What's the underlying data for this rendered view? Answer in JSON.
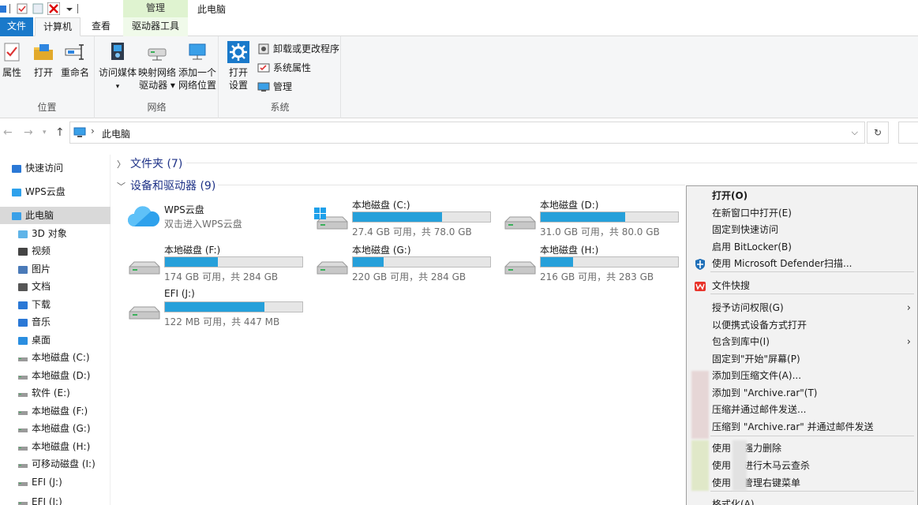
{
  "window": {
    "title": "此电脑",
    "context_tab": "管理"
  },
  "tabs": {
    "file": "文件",
    "computer": "计算机",
    "view": "查看",
    "drive_tools": "驱动器工具"
  },
  "ribbon": {
    "location": {
      "label": "位置",
      "properties": "属性",
      "open": "打开",
      "rename": "重命名"
    },
    "network": {
      "label": "网络",
      "access_media": "访问媒体",
      "map_drive_1": "映射网络",
      "map_drive_2": "驱动器",
      "add_location_1": "添加一个",
      "add_location_2": "网络位置"
    },
    "system": {
      "label": "系统",
      "open_settings_1": "打开",
      "open_settings_2": "设置",
      "uninstall": "卸载或更改程序",
      "sys_props": "系统属性",
      "manage": "管理"
    }
  },
  "address": {
    "crumb": "此电脑",
    "separator": "›"
  },
  "nav": {
    "items": [
      {
        "label": "快速访问",
        "icon": "star-icon"
      },
      {
        "label": "WPS云盘",
        "icon": "cloud-icon"
      },
      {
        "label": "此电脑",
        "icon": "computer-icon",
        "selected": true
      },
      {
        "label": "3D 对象",
        "icon": "cube-icon"
      },
      {
        "label": "视频",
        "icon": "video-icon"
      },
      {
        "label": "图片",
        "icon": "picture-icon"
      },
      {
        "label": "文档",
        "icon": "document-icon"
      },
      {
        "label": "下载",
        "icon": "download-icon"
      },
      {
        "label": "音乐",
        "icon": "music-icon"
      },
      {
        "label": "桌面",
        "icon": "desktop-icon"
      },
      {
        "label": "本地磁盘 (C:)",
        "icon": "drive-icon"
      },
      {
        "label": "本地磁盘 (D:)",
        "icon": "drive-icon"
      },
      {
        "label": "软件 (E:)",
        "icon": "drive-icon"
      },
      {
        "label": "本地磁盘 (F:)",
        "icon": "drive-icon"
      },
      {
        "label": "本地磁盘 (G:)",
        "icon": "drive-icon"
      },
      {
        "label": "本地磁盘 (H:)",
        "icon": "drive-icon"
      },
      {
        "label": "可移动磁盘 (I:)",
        "icon": "drive-icon"
      },
      {
        "label": "EFI (J:)",
        "icon": "drive-icon"
      },
      {
        "label": "EFI (J:)",
        "icon": "drive-icon"
      }
    ]
  },
  "content": {
    "folders_header": "文件夹 (7)",
    "devices_header": "设备和驱动器 (9)",
    "wps": {
      "name": "WPS云盘",
      "desc": "双击进入WPS云盘"
    },
    "drives": [
      {
        "name": "本地磁盘 (C:)",
        "info": "27.4 GB 可用，共 78.0 GB",
        "used_fraction": 0.649
      },
      {
        "name": "本地磁盘 (D:)",
        "info": "31.0 GB 可用，共 80.0 GB",
        "used_fraction": 0.6125
      },
      {
        "name": "本地磁盘 (F:)",
        "info": "174 GB 可用，共 284 GB",
        "used_fraction": 0.387
      },
      {
        "name": "本地磁盘 (G:)",
        "info": "220 GB 可用，共 284 GB",
        "used_fraction": 0.225
      },
      {
        "name": "本地磁盘 (H:)",
        "info": "216 GB 可用，共 283 GB",
        "used_fraction": 0.237
      },
      {
        "name": "EFI (J:)",
        "info": "122 MB 可用，共 447 MB",
        "used_fraction": 0.727
      }
    ]
  },
  "context_menu": {
    "items": [
      {
        "label": "打开(O)",
        "bold": true
      },
      {
        "label": "在新窗口中打开(E)"
      },
      {
        "label": "固定到快速访问"
      },
      {
        "label": "启用 BitLocker(B)"
      },
      {
        "label": "使用 Microsoft Defender扫描...",
        "icon": "defender-shield-icon"
      },
      {
        "label": "文件快搜",
        "icon": "wps-icon"
      },
      {
        "label": "授予访问权限(G)",
        "submenu": true
      },
      {
        "label": "以便携式设备方式打开"
      },
      {
        "label": "包含到库中(I)",
        "submenu": true
      },
      {
        "label": "固定到\"开始\"屏幕(P)"
      },
      {
        "label": "添加到压缩文件(A)..."
      },
      {
        "label": "添加到 \"Archive.rar\"(T)"
      },
      {
        "label": "压缩并通过邮件发送..."
      },
      {
        "label": "压缩到 \"Archive.rar\" 并通过邮件发送"
      },
      {
        "label": "使用",
        "label_b": "强力删除"
      },
      {
        "label": "使用",
        "label_b": "进行木马云查杀"
      },
      {
        "label": "使用",
        "label_b": "管理右键菜单"
      },
      {
        "label": "格式化(A)..."
      }
    ]
  }
}
